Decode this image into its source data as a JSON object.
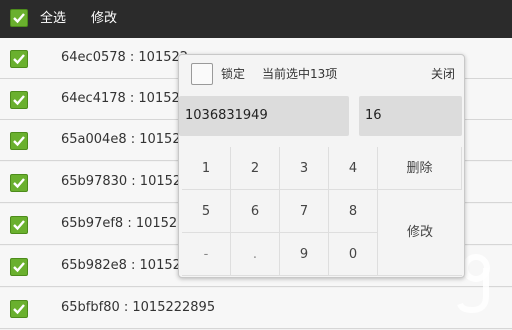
{
  "toolbar": {
    "select_all_label": "全选",
    "edit_label": "修改",
    "background": "#2b2b2b"
  },
  "list": {
    "items": [
      {
        "text": "64ec0578 : 101522",
        "checked": true
      },
      {
        "text": "64ec4178 : 101522",
        "checked": true
      },
      {
        "text": "65a004e8 : 101522",
        "checked": true
      },
      {
        "text": "65b97830 : 101522",
        "checked": true
      },
      {
        "text": "65b97ef8 : 101522",
        "checked": true
      },
      {
        "text": "65b982e8 : 101522",
        "checked": true
      },
      {
        "text": "65bfbf80 : 1015222895",
        "checked": true
      }
    ]
  },
  "dialog": {
    "lock_label": "锁定",
    "selection_status": "当前选中13项",
    "close_label": "关闭",
    "value_field": "1036831949",
    "count_field": "16",
    "keypad": {
      "row1": [
        "1",
        "2",
        "3",
        "4"
      ],
      "row2": [
        "5",
        "6",
        "7",
        "8"
      ],
      "row3": [
        "-",
        ".",
        "9",
        "0"
      ],
      "delete_label": "删除",
      "modify_label": "修改"
    }
  },
  "colors": {
    "checkbox_green": "#6ab02e",
    "dialog_bg": "#f4f4f4"
  }
}
